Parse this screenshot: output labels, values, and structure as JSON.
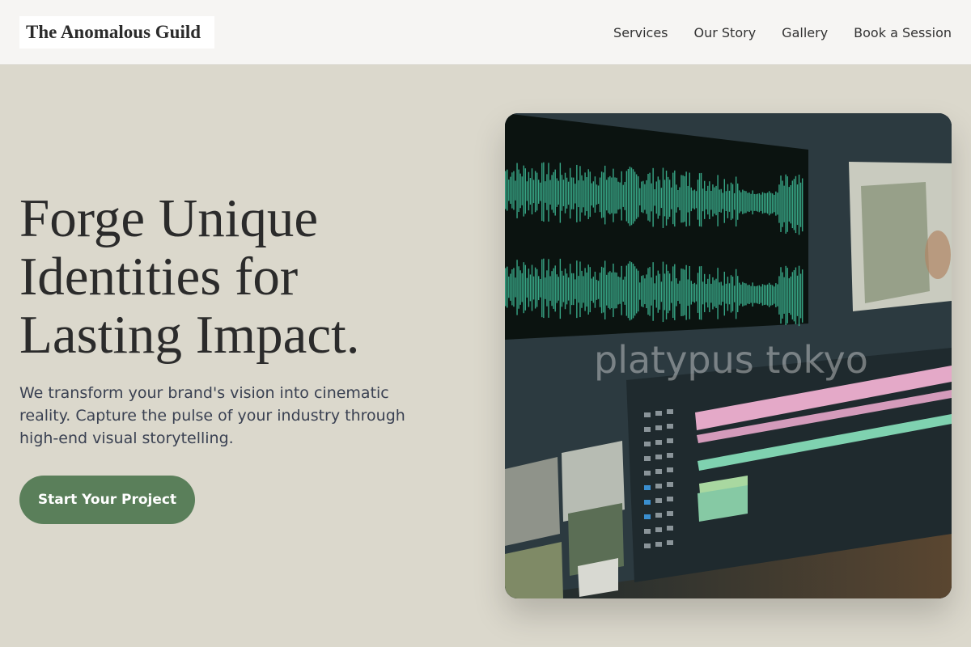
{
  "header": {
    "brand": "The Anomalous Guild",
    "nav": [
      "Services",
      "Our Story",
      "Gallery",
      "Book a Session"
    ]
  },
  "hero": {
    "title_lines": [
      "Forge Unique",
      "Identities for",
      "Lasting Impact."
    ],
    "subtitle_lines": [
      "We transform your brand's vision into cinematic",
      "reality. Capture the pulse of your industry through",
      "high-end visual storytelling."
    ],
    "cta_label": "Start Your Project"
  },
  "media": {
    "image_description_icon": "video-editing-monitor-image",
    "watermark": "platypus tokyo"
  },
  "colors": {
    "page_bg": "#dbd8cc",
    "header_bg": "#f6f5f3",
    "cta_bg": "#5a7f5a",
    "waveform": "#3fbf9a",
    "clip_pink": "#e4a9c8",
    "clip_green": "#7fd2b0"
  }
}
